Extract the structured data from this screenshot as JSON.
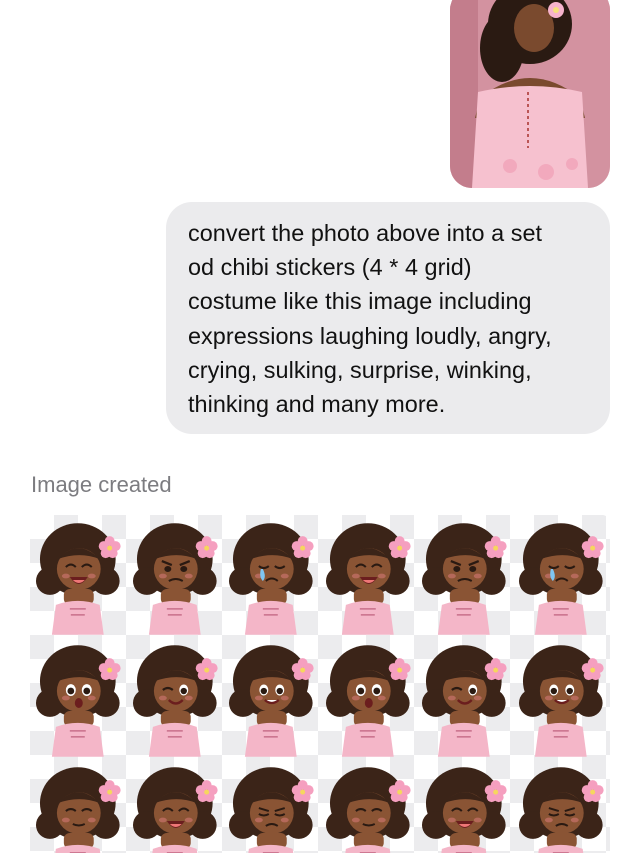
{
  "conversation": {
    "photo_message": {
      "description_icon": "photo-thumbnail"
    },
    "prompt_message": {
      "text": "convert the photo above into a set\nod chibi stickers (4 * 4 grid)\ncostume like this image including\nexpressions laughing loudly, angry,\ncrying, sulking, surprise, winking,\nthinking and many more."
    },
    "result": {
      "status_label": "Image created",
      "sticker_rows": [
        [
          "laughing",
          "angry",
          "crying",
          "laughing",
          "angry",
          "crying"
        ],
        [
          "surprise",
          "winking",
          "smiling",
          "surprise",
          "winking",
          "smiling"
        ],
        [
          "thinking",
          "laughing",
          "sulking",
          "thinking",
          "laughing",
          "sulking"
        ]
      ]
    }
  },
  "colors": {
    "bubble_bg": "#ebebed",
    "status_text": "#7c7c80",
    "skin": "#8a5434",
    "hair": "#3b2418",
    "dress": "#f4b6c8",
    "flower": "#f59fbf"
  }
}
